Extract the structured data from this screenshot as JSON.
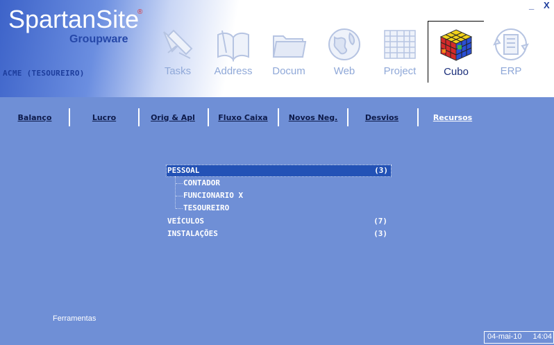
{
  "app": {
    "name": "SpartanSite",
    "registered_mark": "®",
    "subtitle": "Groupware"
  },
  "user": "ACME (TESOUREIRO)",
  "window_controls": {
    "minimize": "_",
    "close": "X"
  },
  "modules": [
    {
      "label": "Tasks",
      "icon": "tasks-icon"
    },
    {
      "label": "Address",
      "icon": "address-book-icon"
    },
    {
      "label": "Docum",
      "icon": "folder-icon"
    },
    {
      "label": "Web",
      "icon": "globe-icon"
    },
    {
      "label": "Project",
      "icon": "calendar-grid-icon"
    },
    {
      "label": "Cubo",
      "icon": "rubik-cube-icon",
      "active": true
    },
    {
      "label": "ERP",
      "icon": "erp-cycle-icon"
    }
  ],
  "tabs": [
    {
      "label": "Balanço"
    },
    {
      "label": "Lucro"
    },
    {
      "label": "Orig & Apl"
    },
    {
      "label": "Fluxo Caixa"
    },
    {
      "label": "Novos Neg."
    },
    {
      "label": "Desvios"
    },
    {
      "label": "Recursos",
      "active": true
    }
  ],
  "tree": [
    {
      "label": "PESSOAL",
      "count": "(3)",
      "selected": true,
      "children": [
        "CONTADOR",
        "FUNCIONARIO X",
        "TESOUREIRO"
      ]
    },
    {
      "label": "VEÍCULOS",
      "count": "(7)"
    },
    {
      "label": "INSTALAÇÕES",
      "count": "(3)"
    }
  ],
  "footer": {
    "tools_label": "Ferramentas",
    "date": "04-mai-10",
    "time": "14:04"
  },
  "colors": {
    "background": "#6f8fd6",
    "selection": "#2352b6",
    "brand": "#2547a8"
  }
}
